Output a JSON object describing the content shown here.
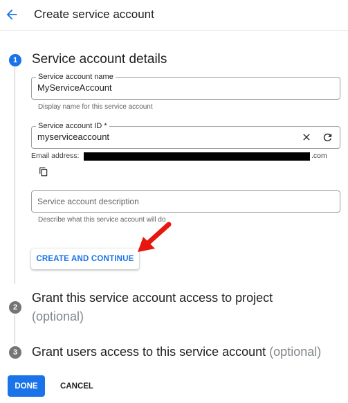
{
  "header": {
    "title": "Create service account",
    "back_icon": "arrow-back-icon"
  },
  "steps": [
    {
      "number": "1",
      "title": "Service account details",
      "state": "active"
    },
    {
      "number": "2",
      "title": "Grant this service account access to project",
      "optional": "(optional)"
    },
    {
      "number": "3",
      "title": "Grant users access to this service account",
      "optional": "(optional)"
    }
  ],
  "form": {
    "name_field": {
      "label": "Service account name",
      "value": "MyServiceAccount",
      "hint": "Display name for this service account"
    },
    "id_field": {
      "label": "Service account ID *",
      "value": "myserviceaccount",
      "clear_icon": "close-icon",
      "refresh_icon": "refresh-icon"
    },
    "email": {
      "label": "Email address:",
      "suffix": ".com",
      "copy_icon": "copy-icon"
    },
    "description_field": {
      "placeholder": "Service account description",
      "hint": "Describe what this service account will do"
    }
  },
  "buttons": {
    "create": "CREATE AND CONTINUE",
    "done": "DONE",
    "cancel": "CANCEL"
  },
  "colors": {
    "accent": "#1a73e8",
    "step_inactive": "#757575",
    "annotation_arrow": "#e8170e",
    "redaction": "#000000"
  }
}
